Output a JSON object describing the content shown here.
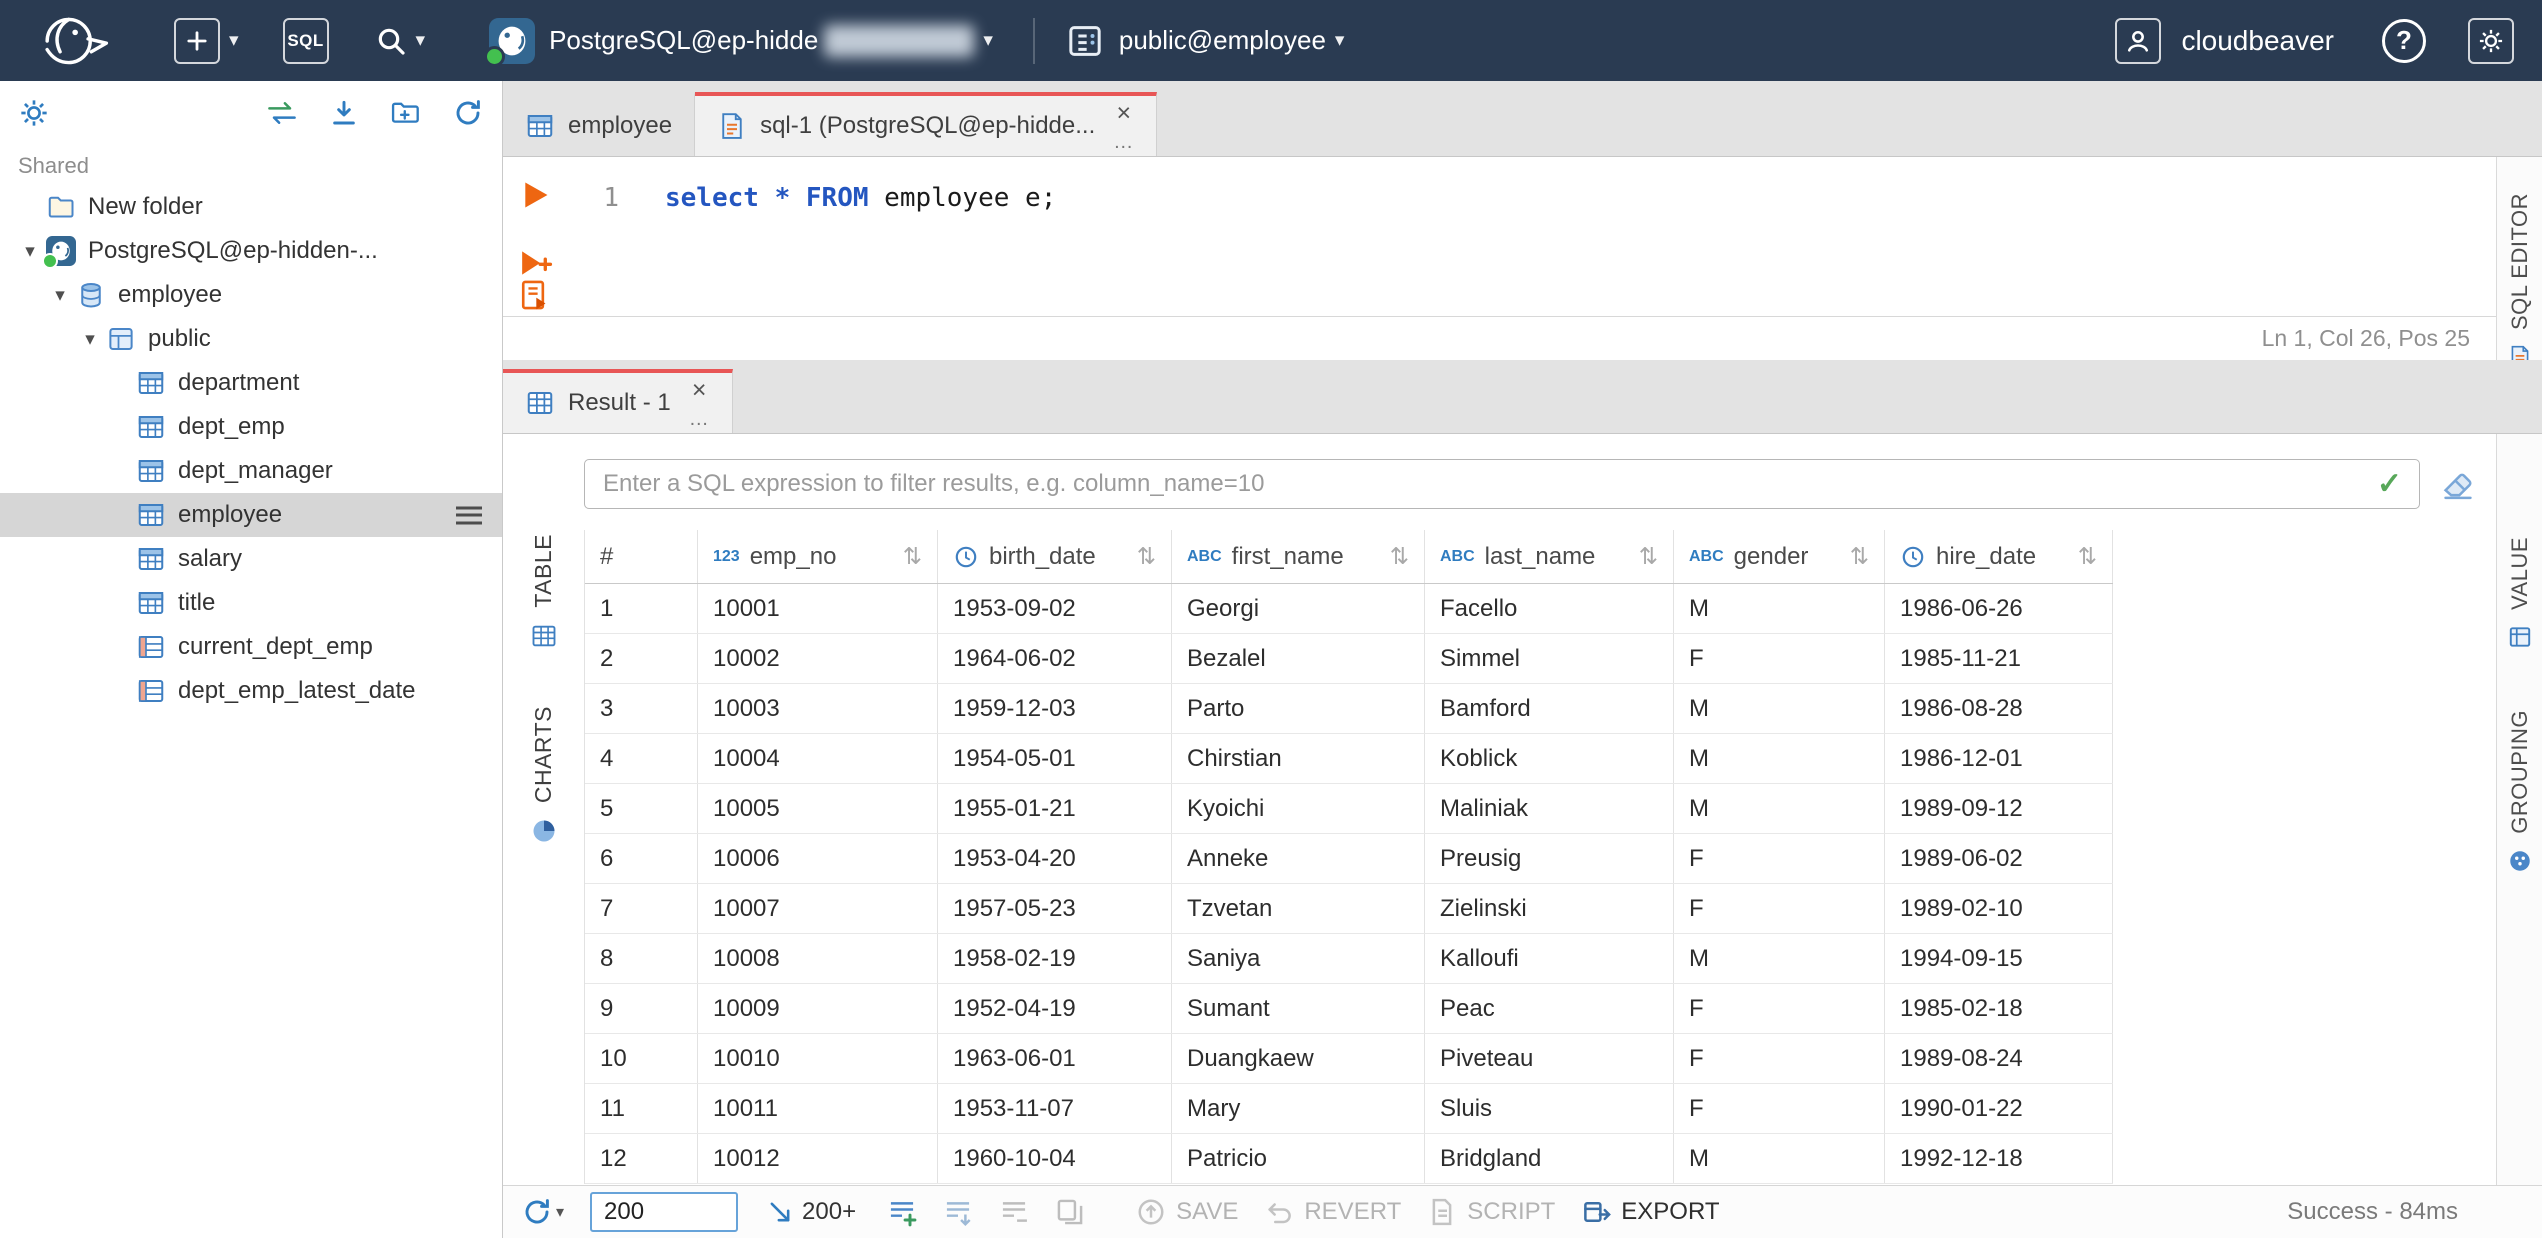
{
  "topbar": {
    "brand": "cloudbeaver",
    "sql_button": "SQL",
    "help_label": "?",
    "connection": {
      "label": "PostgreSQL@ep-hidde",
      "status": "connected"
    },
    "schema": {
      "label": "public@employee"
    },
    "icons": [
      "cloudbeaver-logo",
      "new-connection",
      "sql-editor",
      "search",
      "user",
      "help",
      "settings"
    ]
  },
  "sidebar": {
    "section_label": "Shared",
    "toolbar_icons": [
      "settings-gear",
      "sync-arrows",
      "collapse-all",
      "new-folder",
      "refresh"
    ],
    "tree": [
      {
        "label": "New folder",
        "icon": "folder",
        "indent": 0,
        "expanded": false,
        "selected": false
      },
      {
        "label": "PostgreSQL@ep-hidden-...",
        "icon": "postgres",
        "indent": 0,
        "expanded": true,
        "selected": false
      },
      {
        "label": "employee",
        "icon": "database",
        "indent": 1,
        "expanded": true,
        "selected": false
      },
      {
        "label": "public",
        "icon": "schema",
        "indent": 2,
        "expanded": true,
        "selected": false
      },
      {
        "label": "department",
        "icon": "table",
        "indent": 3,
        "expanded": false,
        "selected": false
      },
      {
        "label": "dept_emp",
        "icon": "table",
        "indent": 3,
        "expanded": false,
        "selected": false
      },
      {
        "label": "dept_manager",
        "icon": "table",
        "indent": 3,
        "expanded": false,
        "selected": false
      },
      {
        "label": "employee",
        "icon": "table",
        "indent": 3,
        "expanded": false,
        "selected": true
      },
      {
        "label": "salary",
        "icon": "table",
        "indent": 3,
        "expanded": false,
        "selected": false
      },
      {
        "label": "title",
        "icon": "table",
        "indent": 3,
        "expanded": false,
        "selected": false
      },
      {
        "label": "current_dept_emp",
        "icon": "view",
        "indent": 3,
        "expanded": false,
        "selected": false
      },
      {
        "label": "dept_emp_latest_date",
        "icon": "view",
        "indent": 3,
        "expanded": false,
        "selected": false
      }
    ]
  },
  "editor": {
    "tabs": [
      {
        "label": "employee",
        "icon": "table",
        "active": false
      },
      {
        "label": "sql-1 (PostgreSQL@ep-hidde...",
        "icon": "sqlfile",
        "active": true
      }
    ],
    "line_number": "1",
    "code": [
      {
        "t": "select",
        "c": "kw"
      },
      {
        "t": " ",
        "c": "p"
      },
      {
        "t": "*",
        "c": "kw"
      },
      {
        "t": " ",
        "c": "p"
      },
      {
        "t": "FROM",
        "c": "kw"
      },
      {
        "t": " employee e;",
        "c": "p"
      }
    ],
    "caret_status": "Ln 1, Col 26, Pos 25",
    "side_tab": "SQL EDITOR"
  },
  "result": {
    "tab_label": "Result - 1",
    "filter_placeholder": "Enter a SQL expression to filter results, e.g. column_name=10",
    "left_tabs": [
      "TABLE",
      "CHARTS"
    ],
    "right_tabs": [
      "VALUE",
      "GROUPING"
    ],
    "grid": {
      "columns": [
        {
          "name": "#",
          "type": null,
          "sortable": false
        },
        {
          "name": "emp_no",
          "type": "num",
          "sortable": true
        },
        {
          "name": "birth_date",
          "type": "date",
          "sortable": true
        },
        {
          "name": "first_name",
          "type": "text",
          "sortable": true
        },
        {
          "name": "last_name",
          "type": "text",
          "sortable": true
        },
        {
          "name": "gender",
          "type": "text",
          "sortable": true
        },
        {
          "name": "hire_date",
          "type": "date",
          "sortable": true
        }
      ],
      "rows": [
        [
          "1",
          "10001",
          "1953-09-02",
          "Georgi",
          "Facello",
          "M",
          "1986-06-26"
        ],
        [
          "2",
          "10002",
          "1964-06-02",
          "Bezalel",
          "Simmel",
          "F",
          "1985-11-21"
        ],
        [
          "3",
          "10003",
          "1959-12-03",
          "Parto",
          "Bamford",
          "M",
          "1986-08-28"
        ],
        [
          "4",
          "10004",
          "1954-05-01",
          "Chirstian",
          "Koblick",
          "M",
          "1986-12-01"
        ],
        [
          "5",
          "10005",
          "1955-01-21",
          "Kyoichi",
          "Maliniak",
          "M",
          "1989-09-12"
        ],
        [
          "6",
          "10006",
          "1953-04-20",
          "Anneke",
          "Preusig",
          "F",
          "1989-06-02"
        ],
        [
          "7",
          "10007",
          "1957-05-23",
          "Tzvetan",
          "Zielinski",
          "F",
          "1989-02-10"
        ],
        [
          "8",
          "10008",
          "1958-02-19",
          "Saniya",
          "Kalloufi",
          "M",
          "1994-09-15"
        ],
        [
          "9",
          "10009",
          "1952-04-19",
          "Sumant",
          "Peac",
          "F",
          "1985-02-18"
        ],
        [
          "10",
          "10010",
          "1963-06-01",
          "Duangkaew",
          "Piveteau",
          "F",
          "1989-08-24"
        ],
        [
          "11",
          "10011",
          "1953-11-07",
          "Mary",
          "Sluis",
          "F",
          "1990-01-22"
        ],
        [
          "12",
          "10012",
          "1960-10-04",
          "Patricio",
          "Bridgland",
          "M",
          "1992-12-18"
        ]
      ]
    }
  },
  "statusbar": {
    "rowcount_value": "200",
    "fetch_more_label": "200+",
    "save_label": "SAVE",
    "revert_label": "REVERT",
    "script_label": "SCRIPT",
    "export_label": "EXPORT",
    "status_text": "Success - 84ms"
  },
  "colors": {
    "topbar_bg": "#2a3b52",
    "accent_blue": "#2f7cc0",
    "tab_accent_red": "#e85656",
    "execute_orange": "#ee6611",
    "success_green": "#58a85a",
    "selected_row_bg": "#d6d6d6"
  }
}
